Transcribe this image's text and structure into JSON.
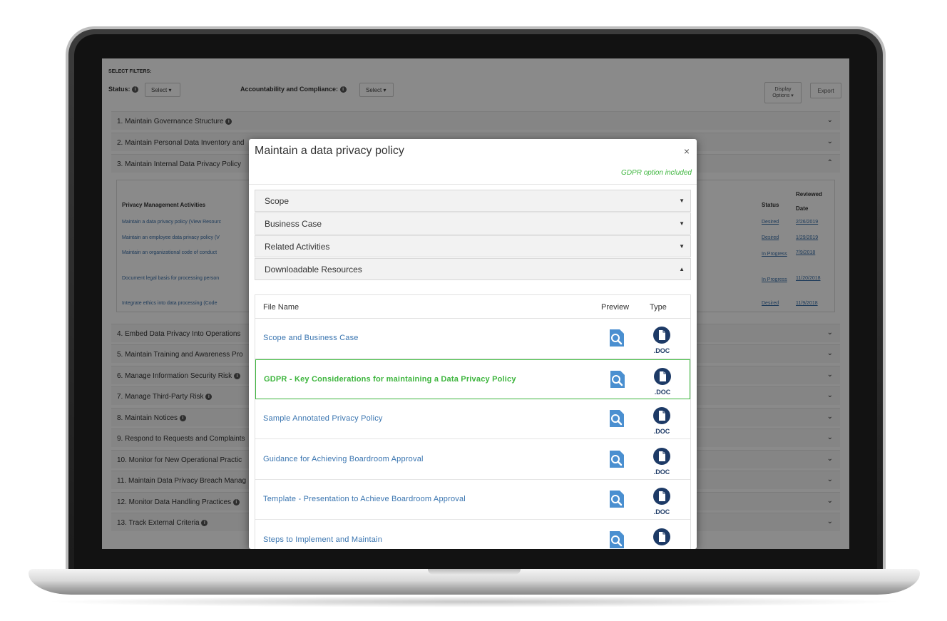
{
  "filters": {
    "heading": "SELECT FILTERS:",
    "status_label": "Status:",
    "status_select": "Select ▾",
    "accountability_label": "Accountability and Compliance:",
    "accountability_select": "Select ▾",
    "display_options": "Display Options ▾",
    "export": "Export"
  },
  "accordion": [
    "1. Maintain Governance Structure",
    "2. Maintain Personal Data Inventory and",
    "3. Maintain Internal Data Privacy Policy",
    "4. Embed Data Privacy Into Operations",
    "5. Maintain Training and Awareness Pro",
    "6. Manage Information Security Risk",
    "7. Manage Third-Party Risk",
    "8. Maintain Notices",
    "9. Respond to Requests and Complaints",
    "10. Monitor for New Operational Practic",
    "11. Maintain Data Privacy Breach Manag",
    "12. Monitor Data Handling Practices",
    "13. Track External Criteria"
  ],
  "activities_table": {
    "header_activity": "Privacy Management Activities",
    "header_status": "Status",
    "header_reviewed": "Reviewed Date",
    "rows": [
      {
        "activity": "Maintain a data privacy policy (View Resourc",
        "status": "Desired",
        "date": "2/26/2019"
      },
      {
        "activity": "Maintain an employee data privacy policy (V",
        "status": "Desired",
        "date": "1/29/2019"
      },
      {
        "activity": "Maintain an organizational code of conduct",
        "status": "In Progress",
        "date": "7/9/2018"
      },
      {
        "activity": "Document legal basis for processing person",
        "status": "In Progress",
        "date": "11/20/2018"
      },
      {
        "activity": "Integrate ethics into data processing (Code",
        "status": "Desired",
        "date": "11/9/2018"
      }
    ]
  },
  "modal": {
    "title": "Maintain a data privacy policy",
    "close": "×",
    "gdpr_note": "GDPR option included",
    "sections": [
      {
        "label": "Scope",
        "caret": "▼"
      },
      {
        "label": "Business Case",
        "caret": "▼"
      },
      {
        "label": "Related Activities",
        "caret": "▼"
      },
      {
        "label": "Downloadable Resources",
        "caret": "▲"
      }
    ],
    "files_header": {
      "name": "File Name",
      "preview": "Preview",
      "type": "Type"
    },
    "doc_label": ".DOC",
    "files": [
      "Scope and Business Case",
      "GDPR - Key Considerations for maintaining a Data Privacy Policy",
      "Sample Annotated Privacy Policy",
      "Guidance for Achieving Boardroom Approval",
      "Template - Presentation to Achieve Boardroom Approval",
      "Steps to Implement and Maintain"
    ]
  },
  "colors": {
    "link": "#3a75b0",
    "gdpr_green": "#3db53d",
    "icon_blue": "#4a8fd0",
    "doc_navy": "#1d3a66"
  }
}
